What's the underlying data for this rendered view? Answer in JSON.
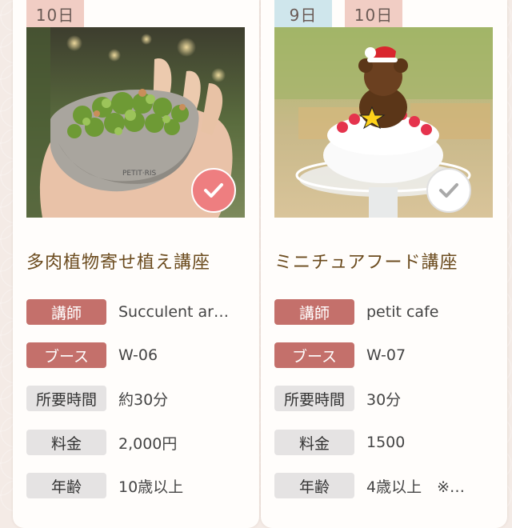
{
  "courses": [
    {
      "tags": [
        "10日"
      ],
      "title": "多肉植物寄せ植え講座",
      "checked_style": "pink",
      "info": [
        {
          "label": "講師",
          "value": "Succulent ar…"
        },
        {
          "label": "ブース",
          "value": "W-06"
        },
        {
          "label": "所要時間",
          "value": "約30分"
        },
        {
          "label": "料金",
          "value": "2,000円"
        },
        {
          "label": "年齢",
          "value": "10歳以上"
        }
      ]
    },
    {
      "tags": [
        "9日",
        "10日"
      ],
      "title": "ミニチュアフード講座",
      "checked_style": "white",
      "info": [
        {
          "label": "講師",
          "value": "petit cafe"
        },
        {
          "label": "ブース",
          "value": "W-07"
        },
        {
          "label": "所要時間",
          "value": "30分"
        },
        {
          "label": "料金",
          "value": "1500"
        },
        {
          "label": "年齢",
          "value": "4歳以上　※…"
        }
      ]
    }
  ],
  "icons": {
    "checkmark": "check-icon"
  },
  "colors": {
    "accent_brown": "#c4706b",
    "label_grey": "#e5e3e3",
    "title_color": "#6b4b1e",
    "tag_pink": "#f1cdc4",
    "tag_blue": "#cfe6ec",
    "check_pink": "#ee7e80"
  }
}
